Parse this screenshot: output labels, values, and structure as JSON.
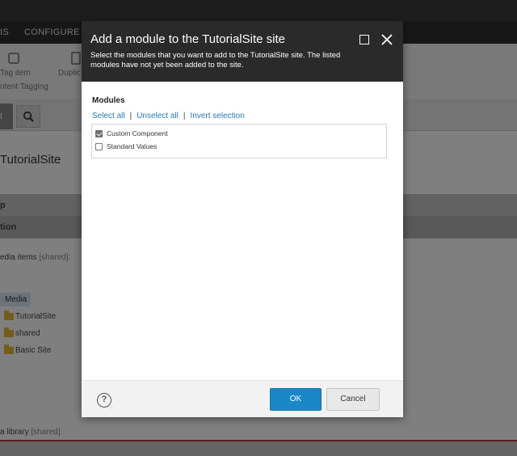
{
  "background": {
    "menu": [
      "IS",
      "CONFIGURE"
    ],
    "ribbon_labels": [
      "Tag item",
      "Duplic",
      "ntent Tagging"
    ],
    "tab_label": "t",
    "page_title": "TutorialSite",
    "strip1_label": "p",
    "strip2_label": "tion",
    "media_items_label": "edia items",
    "media_items_shared": "[shared]:",
    "media_root": "Media",
    "tree_items": [
      "TutorialSite",
      "shared",
      "Basic Site"
    ],
    "media_library_label": "a library",
    "media_library_shared": "[shared]:"
  },
  "dialog": {
    "title": "Add a module to the TutorialSite site",
    "subtitle": "Select the modules that you want to add to the TutorialSite site. The listed modules have not yet been added to the site.",
    "modules_heading": "Modules",
    "select_all": "Select all",
    "unselect_all": "Unselect all",
    "invert_selection": "Invert selection",
    "separator": "|",
    "modules": [
      {
        "label": "Custom Component",
        "checked": true
      },
      {
        "label": "Standard Values",
        "checked": false
      }
    ],
    "help_label": "?",
    "ok_label": "OK",
    "cancel_label": "Cancel"
  },
  "colors": {
    "header_bg": "#2a2a2a",
    "ok_button": "#1a87c7",
    "link": "#2c7ab3"
  }
}
